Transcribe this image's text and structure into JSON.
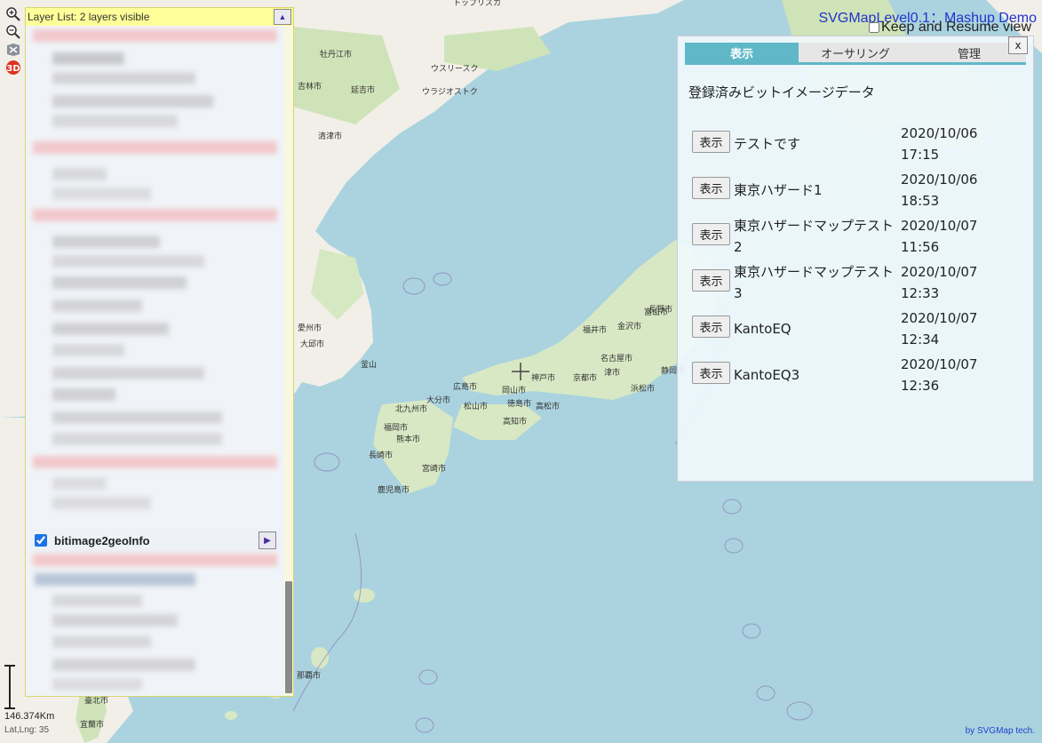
{
  "header": {
    "title": "SVGMapLevel0.1：Mashup Demo",
    "keep_label": "Keep and Resume view"
  },
  "tools": [
    {
      "icon": "zoom-in-icon"
    },
    {
      "icon": "zoom-out-icon"
    },
    {
      "icon": "gps-icon"
    },
    {
      "icon": "3d-view-icon",
      "label": "3D"
    }
  ],
  "layer_list": {
    "header": "Layer List: 2 layers visible",
    "layer": {
      "name": "bitimage2geoInfo",
      "checked": true
    }
  },
  "scale": {
    "label": "146.374Km"
  },
  "latlng": "Lat,Lng: 35",
  "credit": "by SVGMap tech.",
  "dialog": {
    "close_label": "x",
    "tabs": [
      {
        "label": "表示",
        "active": true
      },
      {
        "label": "オーサリング",
        "active": false
      },
      {
        "label": "管理",
        "active": false
      }
    ],
    "heading": "登録済みビットイメージデータ",
    "show_label": "表示",
    "rows": [
      {
        "name": "テストです",
        "date": "2020/10/06",
        "time": "17:15"
      },
      {
        "name": "東京ハザード1",
        "date": "2020/10/06",
        "time": "18:53"
      },
      {
        "name": "東京ハザードマップテスト2",
        "date": "2020/10/07",
        "time": "11:56"
      },
      {
        "name": "東京ハザードマップテスト3",
        "date": "2020/10/07",
        "time": "12:33"
      },
      {
        "name": "KantoEQ",
        "date": "2020/10/07",
        "time": "12:34"
      },
      {
        "name": "KantoEQ3",
        "date": "2020/10/07",
        "time": "12:36"
      }
    ]
  },
  "map_labels": [
    "牡丹江市",
    "ウスリースク",
    "トップリスカ",
    "ウラジオストク",
    "吉林市",
    "延吉市",
    "清津市",
    "愛州市",
    "大邱市",
    "釜山",
    "広島市",
    "岡山市",
    "神戸市",
    "京都市",
    "名古屋市",
    "福岡市",
    "熊本市",
    "鹿児島市",
    "宮崎市",
    "高知市",
    "松山市",
    "福井市",
    "富山市",
    "金沢市",
    "長野市",
    "静岡市",
    "浜松市",
    "津市",
    "高松市",
    "徳島市",
    "大分市",
    "北九州市",
    "長崎市",
    "那覇市",
    "臺北市",
    "宜蘭市"
  ]
}
